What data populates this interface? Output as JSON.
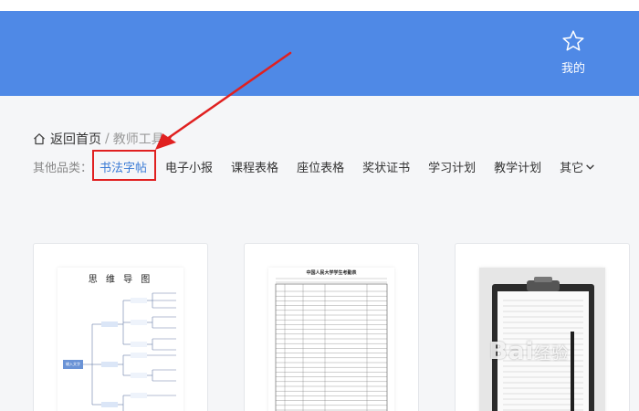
{
  "header": {
    "mine_label": "我的",
    "mine_icon": "star-icon",
    "background_color": "#4f89e6"
  },
  "breadcrumb": {
    "home_icon": "home-icon",
    "home_label": "返回首页",
    "separator": "/",
    "current_label": "教师工具"
  },
  "categories": {
    "label": "其他品类：",
    "items": [
      {
        "label": "书法字帖",
        "active": true
      },
      {
        "label": "电子小报"
      },
      {
        "label": "课程表格"
      },
      {
        "label": "座位表格"
      },
      {
        "label": "奖状证书"
      },
      {
        "label": "学习计划"
      },
      {
        "label": "教学计划"
      }
    ],
    "more_label": "其它",
    "more_icon": "chevron-down-icon",
    "active_color": "#3a7bd5"
  },
  "annotation": {
    "highlight_color": "#e02020",
    "arrow_color": "#e02020"
  },
  "cards": [
    {
      "thumb_title": "思 维 导 图",
      "node_text": "输入文字"
    },
    {
      "thumb_title": "中国人民大学学生考勤表"
    },
    {
      "thumb_kind": "clipboard"
    }
  ],
  "watermark": {
    "brand": "Bai",
    "suffix": "经验"
  }
}
